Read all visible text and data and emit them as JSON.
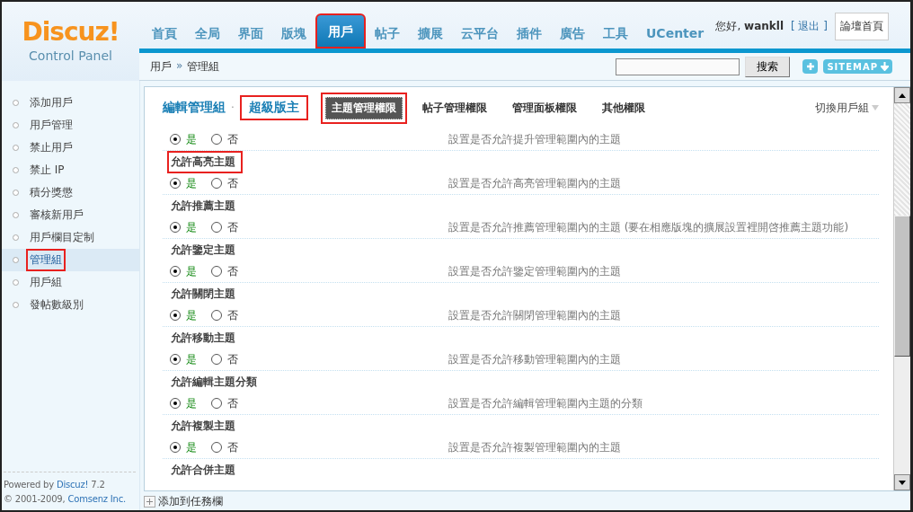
{
  "logo": {
    "name": "Discuz!",
    "subtitle": "Control Panel"
  },
  "nav": [
    {
      "label": "首頁",
      "selected": false,
      "annotated": false
    },
    {
      "label": "全局",
      "selected": false,
      "annotated": false
    },
    {
      "label": "界面",
      "selected": false,
      "annotated": false
    },
    {
      "label": "版塊",
      "selected": false,
      "annotated": false
    },
    {
      "label": "用戶",
      "selected": true,
      "annotated": true
    },
    {
      "label": "帖子",
      "selected": false,
      "annotated": false
    },
    {
      "label": "擴展",
      "selected": false,
      "annotated": false
    },
    {
      "label": "云平台",
      "selected": false,
      "annotated": false
    },
    {
      "label": "插件",
      "selected": false,
      "annotated": false
    },
    {
      "label": "廣告",
      "selected": false,
      "annotated": false
    },
    {
      "label": "工具",
      "selected": false,
      "annotated": false
    },
    {
      "label": "UCenter",
      "selected": false,
      "annotated": false
    }
  ],
  "user": {
    "greeting": "您好,",
    "username": "wankll",
    "logout": "[ 退出 ]"
  },
  "home_button": "論壇首頁",
  "breadcrumb": {
    "items": [
      "用戶",
      "管理組"
    ],
    "separator": "»"
  },
  "search": {
    "button": "搜索"
  },
  "sitemap": {
    "label": "SITEMAP"
  },
  "sidebar": {
    "items": [
      {
        "label": "添加用戶",
        "selected": false,
        "annotated": false
      },
      {
        "label": "用戶管理",
        "selected": false,
        "annotated": false
      },
      {
        "label": "禁止用戶",
        "selected": false,
        "annotated": false
      },
      {
        "label": "禁止 IP",
        "selected": false,
        "annotated": false
      },
      {
        "label": "積分獎懲",
        "selected": false,
        "annotated": false
      },
      {
        "label": "審核新用戶",
        "selected": false,
        "annotated": false
      },
      {
        "label": "用戶欄目定制",
        "selected": false,
        "annotated": false
      },
      {
        "label": "管理組",
        "selected": true,
        "annotated": true
      },
      {
        "label": "用戶組",
        "selected": false,
        "annotated": false
      },
      {
        "label": "發帖數級別",
        "selected": false,
        "annotated": false
      }
    ]
  },
  "footer": {
    "powered": "Powered by",
    "product": "Discuz!",
    "version": "7.2",
    "copyright": "© 2001-2009,",
    "company": "Comsenz Inc."
  },
  "panel": {
    "title": "編輯管理組",
    "separator": "·",
    "group": {
      "label": "超級版主",
      "annotated": true
    },
    "tabs": [
      {
        "label": "主題管理權限",
        "selected": true,
        "annotated": true
      },
      {
        "label": "帖子管理權限",
        "selected": false,
        "annotated": false
      },
      {
        "label": "管理面板權限",
        "selected": false,
        "annotated": false
      },
      {
        "label": "其他權限",
        "selected": false,
        "annotated": false
      }
    ],
    "switch": "切換用戶組"
  },
  "settings": [
    {
      "options": [
        {
          "label": "是",
          "selected": true
        },
        {
          "label": "否",
          "selected": false
        }
      ],
      "description": "設置是否允許提升管理範圍內的主題"
    },
    {
      "title": "允許高亮主題",
      "annotated": true,
      "options": [
        {
          "label": "是",
          "selected": true
        },
        {
          "label": "否",
          "selected": false
        }
      ],
      "description": "設置是否允許高亮管理範圍內的主題"
    },
    {
      "title": "允許推薦主題",
      "annotated": false,
      "options": [
        {
          "label": "是",
          "selected": true
        },
        {
          "label": "否",
          "selected": false
        }
      ],
      "description": "設置是否允許推薦管理範圍內的主題 (要在相應版塊的擴展設置裡開啓推薦主題功能)"
    },
    {
      "title": "允許鑒定主題",
      "annotated": false,
      "options": [
        {
          "label": "是",
          "selected": true
        },
        {
          "label": "否",
          "selected": false
        }
      ],
      "description": "設置是否允許鑒定管理範圍內的主題"
    },
    {
      "title": "允許關閉主題",
      "annotated": false,
      "options": [
        {
          "label": "是",
          "selected": true
        },
        {
          "label": "否",
          "selected": false
        }
      ],
      "description": "設置是否允許關閉管理範圍內的主題"
    },
    {
      "title": "允許移動主題",
      "annotated": false,
      "options": [
        {
          "label": "是",
          "selected": true
        },
        {
          "label": "否",
          "selected": false
        }
      ],
      "description": "設置是否允許移動管理範圍內的主題"
    },
    {
      "title": "允許編輯主題分類",
      "annotated": false,
      "options": [
        {
          "label": "是",
          "selected": true
        },
        {
          "label": "否",
          "selected": false
        }
      ],
      "description": "設置是否允許編輯管理範圍內主題的分類"
    },
    {
      "title": "允許複製主題",
      "annotated": false,
      "options": [
        {
          "label": "是",
          "selected": true
        },
        {
          "label": "否",
          "selected": false
        }
      ],
      "description": "設置是否允許複製管理範圍內的主題"
    },
    {
      "title": "允許合併主題",
      "annotated": false
    }
  ],
  "taskbar": "添加到任務欄"
}
